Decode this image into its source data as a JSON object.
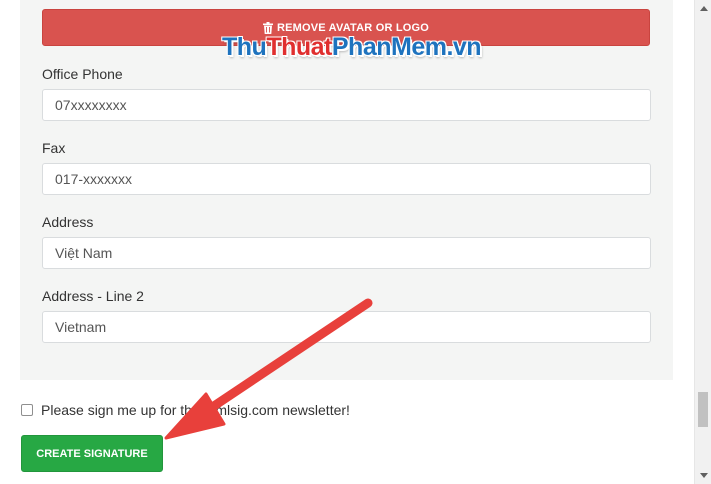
{
  "form": {
    "remove_button_label": "REMOVE AVATAR OR LOGO",
    "fields": [
      {
        "label": "Office Phone",
        "value": "07xxxxxxxx"
      },
      {
        "label": "Fax",
        "value": "017-xxxxxxx"
      },
      {
        "label": "Address",
        "value": "Việt Nam"
      },
      {
        "label": "Address - Line 2",
        "value": "Vietnam"
      }
    ],
    "newsletter_label": "Please sign me up for the htmlsig.com newsletter!",
    "create_button_label": "CREATE SIGNATURE"
  },
  "watermark": {
    "part1": "Thu",
    "part2": "Thuat",
    "part3": "PhanMem.vn"
  },
  "icons": {
    "remove": "trash-icon",
    "arrow": "red-arrow-annotation"
  },
  "colors": {
    "remove_button": "#d9534f",
    "create_button": "#27a844",
    "arrow": "#e8403b"
  }
}
